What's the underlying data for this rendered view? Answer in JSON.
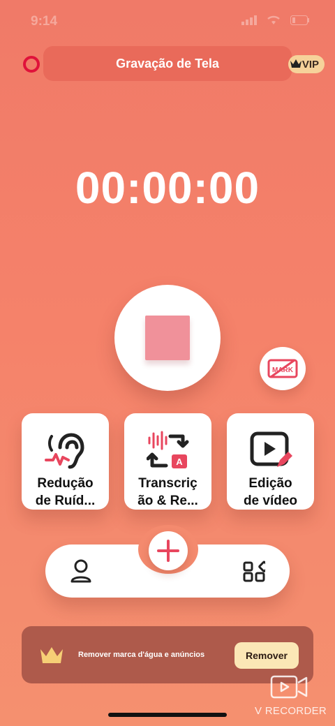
{
  "status_bar": {
    "time": "9:14"
  },
  "header": {
    "title": "Gravação de Tela",
    "vip_label": "VIP"
  },
  "timer": {
    "value": "00:00:00"
  },
  "mark_button": {
    "label": "MARK"
  },
  "tools": [
    {
      "label": "Redução\nde Ruíd...",
      "icon": "ear-noise-icon"
    },
    {
      "label": "Transcriç\não & Re...",
      "icon": "transcription-icon"
    },
    {
      "label": "Edição\nde vídeo",
      "icon": "video-edit-icon"
    }
  ],
  "promo": {
    "text": "Remover marca d'água e anúncios",
    "button": "Remover"
  },
  "watermark": {
    "text": "V RECORDER"
  },
  "colors": {
    "accent": "#e8465e",
    "record": "#e0123a",
    "stop": "#f0919a"
  }
}
